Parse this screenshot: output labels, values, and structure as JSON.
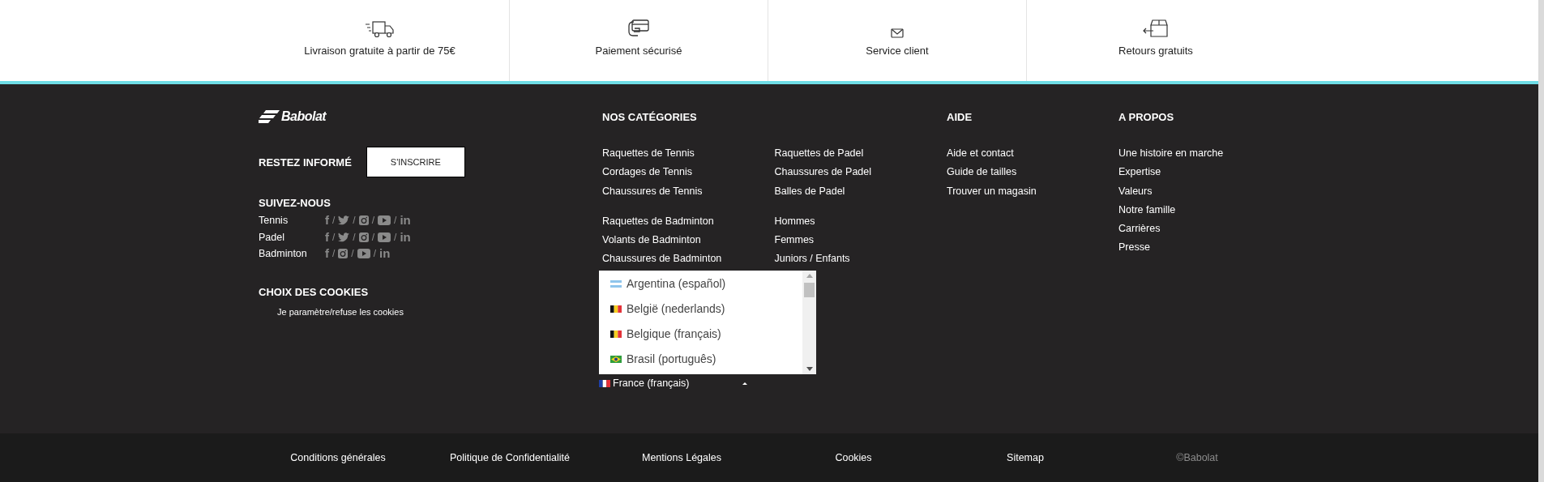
{
  "features": [
    {
      "kind": "truck",
      "label": "Livraison gratuite à partir de 75€"
    },
    {
      "kind": "card",
      "label": "Paiement sécurisé"
    },
    {
      "kind": "envelope",
      "label": "Service client"
    },
    {
      "kind": "return",
      "label": "Retours gratuits"
    }
  ],
  "brand": {
    "logo": "Babolat"
  },
  "newsletter": {
    "title": "RESTEZ INFORMÉ",
    "button": "S'INSCRIRE"
  },
  "social": {
    "title": "SUIVEZ-NOUS",
    "separator": "/",
    "rows": [
      {
        "label": "Tennis",
        "networks": [
          {
            "kind": "facebook",
            "glyph": "f"
          },
          {
            "kind": "twitter"
          },
          {
            "kind": "instagram"
          },
          {
            "kind": "youtube"
          },
          {
            "kind": "linkedin",
            "glyph": "in"
          }
        ]
      },
      {
        "label": "Padel",
        "networks": [
          {
            "kind": "facebook",
            "glyph": "f"
          },
          {
            "kind": "twitter"
          },
          {
            "kind": "instagram"
          },
          {
            "kind": "youtube"
          },
          {
            "kind": "linkedin",
            "glyph": "in"
          }
        ]
      },
      {
        "label": "Badminton",
        "networks": [
          {
            "kind": "facebook",
            "glyph": "f"
          },
          {
            "kind": "instagram"
          },
          {
            "kind": "youtube"
          },
          {
            "kind": "linkedin",
            "glyph": "in"
          }
        ]
      }
    ]
  },
  "cookies": {
    "title": "CHOIX DES COOKIES",
    "link": "Je paramètre/refuse les cookies"
  },
  "categories": {
    "title": "NOS CATÉGORIES",
    "columns": [
      {
        "groups": [
          [
            "Raquettes de Tennis",
            "Cordages de Tennis",
            "Chaussures de Tennis"
          ],
          [
            "Raquettes de Badminton",
            "Volants de Badminton",
            "Chaussures de Badminton"
          ]
        ]
      },
      {
        "groups": [
          [
            "Raquettes de Padel",
            "Chaussures de Padel",
            "Balles de Padel"
          ],
          [
            "Hommes",
            "Femmes",
            "Juniors / Enfants"
          ]
        ]
      }
    ]
  },
  "language": {
    "current": {
      "label": "France (français)",
      "kind": "bluewhitered"
    },
    "expanded": true,
    "options": [
      {
        "label": "Argentina (español)",
        "selected": false,
        "kind": "skystripes"
      },
      {
        "label": "België (nederlands)",
        "selected": false,
        "kind": "blackyellowred"
      },
      {
        "label": "Belgique (français)",
        "selected": false,
        "kind": "blackyellowred"
      },
      {
        "label": "Brasil (português)",
        "selected": false,
        "kind": "greendiamond"
      }
    ]
  },
  "help": {
    "title": "AIDE",
    "links": [
      "Aide et contact",
      "Guide de tailles",
      "Trouver un magasin"
    ]
  },
  "about": {
    "title": "A PROPOS",
    "links": [
      "Une histoire en marche",
      "Expertise",
      "Valeurs",
      "Notre famille",
      "Carrières",
      "Presse"
    ]
  },
  "bottom_bar": {
    "links": [
      "Conditions générales",
      "Politique de Confidentialité",
      "Mentions Légales",
      "Cookies",
      "Sitemap"
    ],
    "copyright": "©Babolat"
  }
}
